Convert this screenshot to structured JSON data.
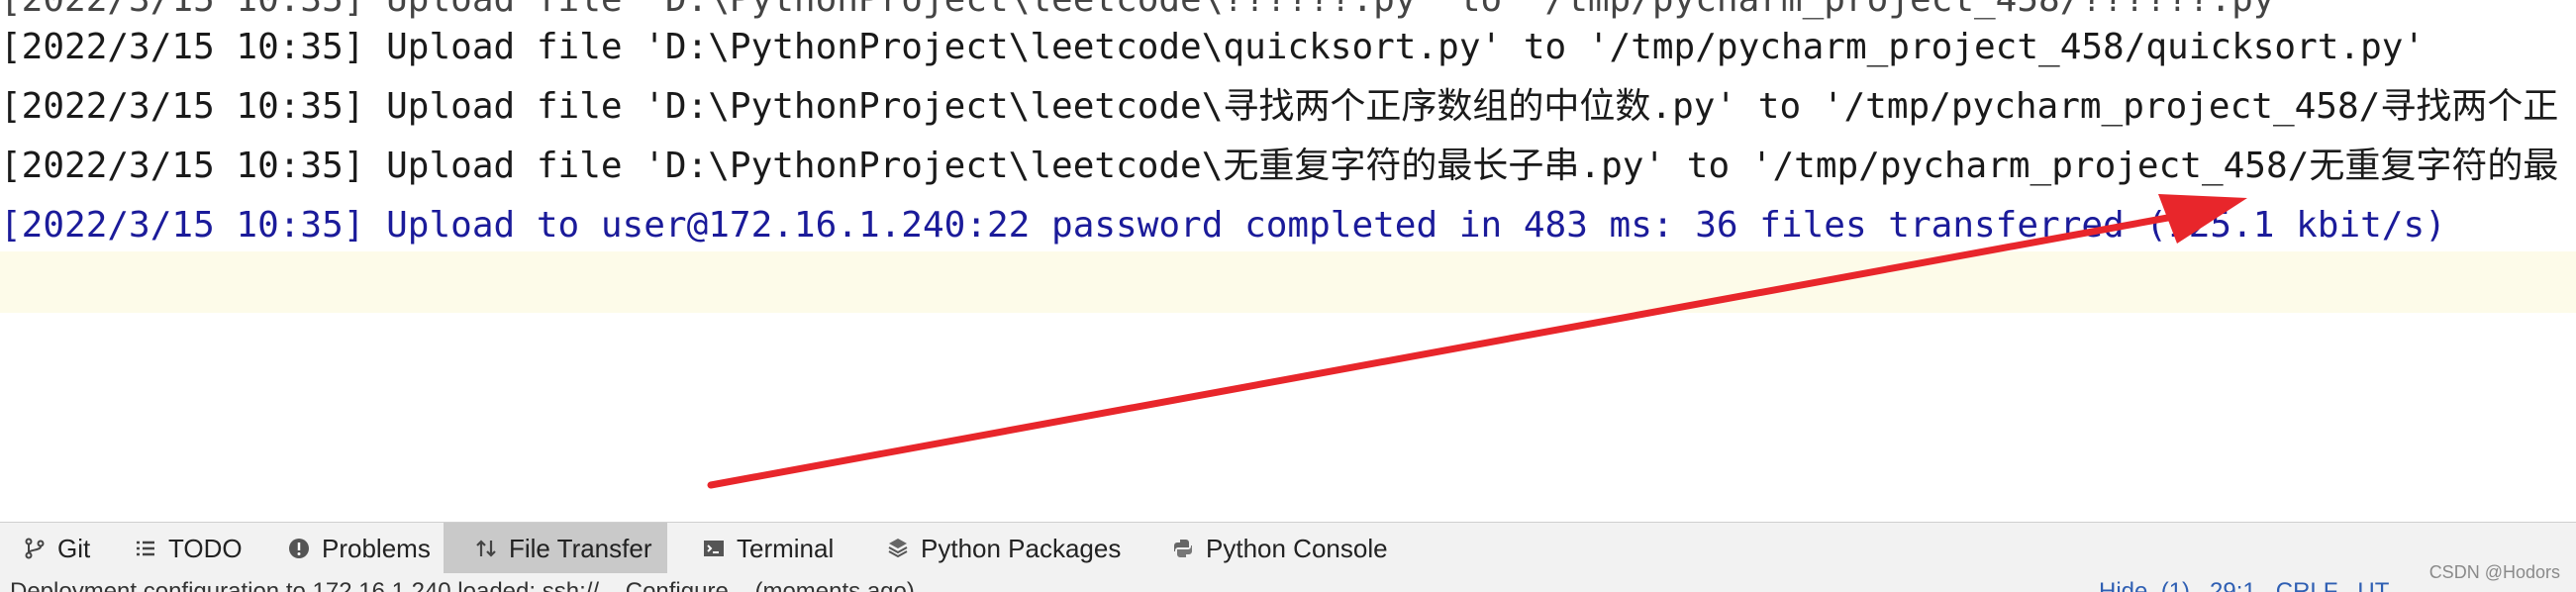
{
  "log": {
    "partial_top_line": "[2022/3/15 10:35] Upload file 'D:\\PythonProject\\leetcode\\??????.py' to '/tmp/pycharm_project_458/??????.py'",
    "lines": [
      "[2022/3/15 10:35] Upload file 'D:\\PythonProject\\leetcode\\quicksort.py' to '/tmp/pycharm_project_458/quicksort.py'",
      "[2022/3/15 10:35] Upload file 'D:\\PythonProject\\leetcode\\寻找两个正序数组的中位数.py' to '/tmp/pycharm_project_458/寻找两个正",
      "[2022/3/15 10:35] Upload file 'D:\\PythonProject\\leetcode\\无重复字符的最长子串.py' to '/tmp/pycharm_project_458/无重复字符的最"
    ],
    "summary": "[2022/3/15 10:35] Upload to user@172.16.1.240:22 password completed in 483 ms: 36 files transferred (125.1 kbit/s)"
  },
  "annotation": {
    "arrow_color": "#e8262b"
  },
  "tool_windows": {
    "tabs": [
      {
        "label": "Git",
        "icon": "git-branch-icon"
      },
      {
        "label": "TODO",
        "icon": "todo-list-icon"
      },
      {
        "label": "Problems",
        "icon": "problems-icon"
      },
      {
        "label": "File Transfer",
        "icon": "file-transfer-icon",
        "active": true
      },
      {
        "label": "Terminal",
        "icon": "terminal-icon"
      },
      {
        "label": "Python Packages",
        "icon": "python-packages-icon"
      },
      {
        "label": "Python Console",
        "icon": "python-console-icon"
      }
    ]
  },
  "status_bar": {
    "message": "Deployment configuration to 172.16.1.240 loaded: ssh://... Configure... (moments ago)",
    "right_hint": "Hide  (1)   29:1   CRLF   UT"
  },
  "watermark": "CSDN @Hodors"
}
